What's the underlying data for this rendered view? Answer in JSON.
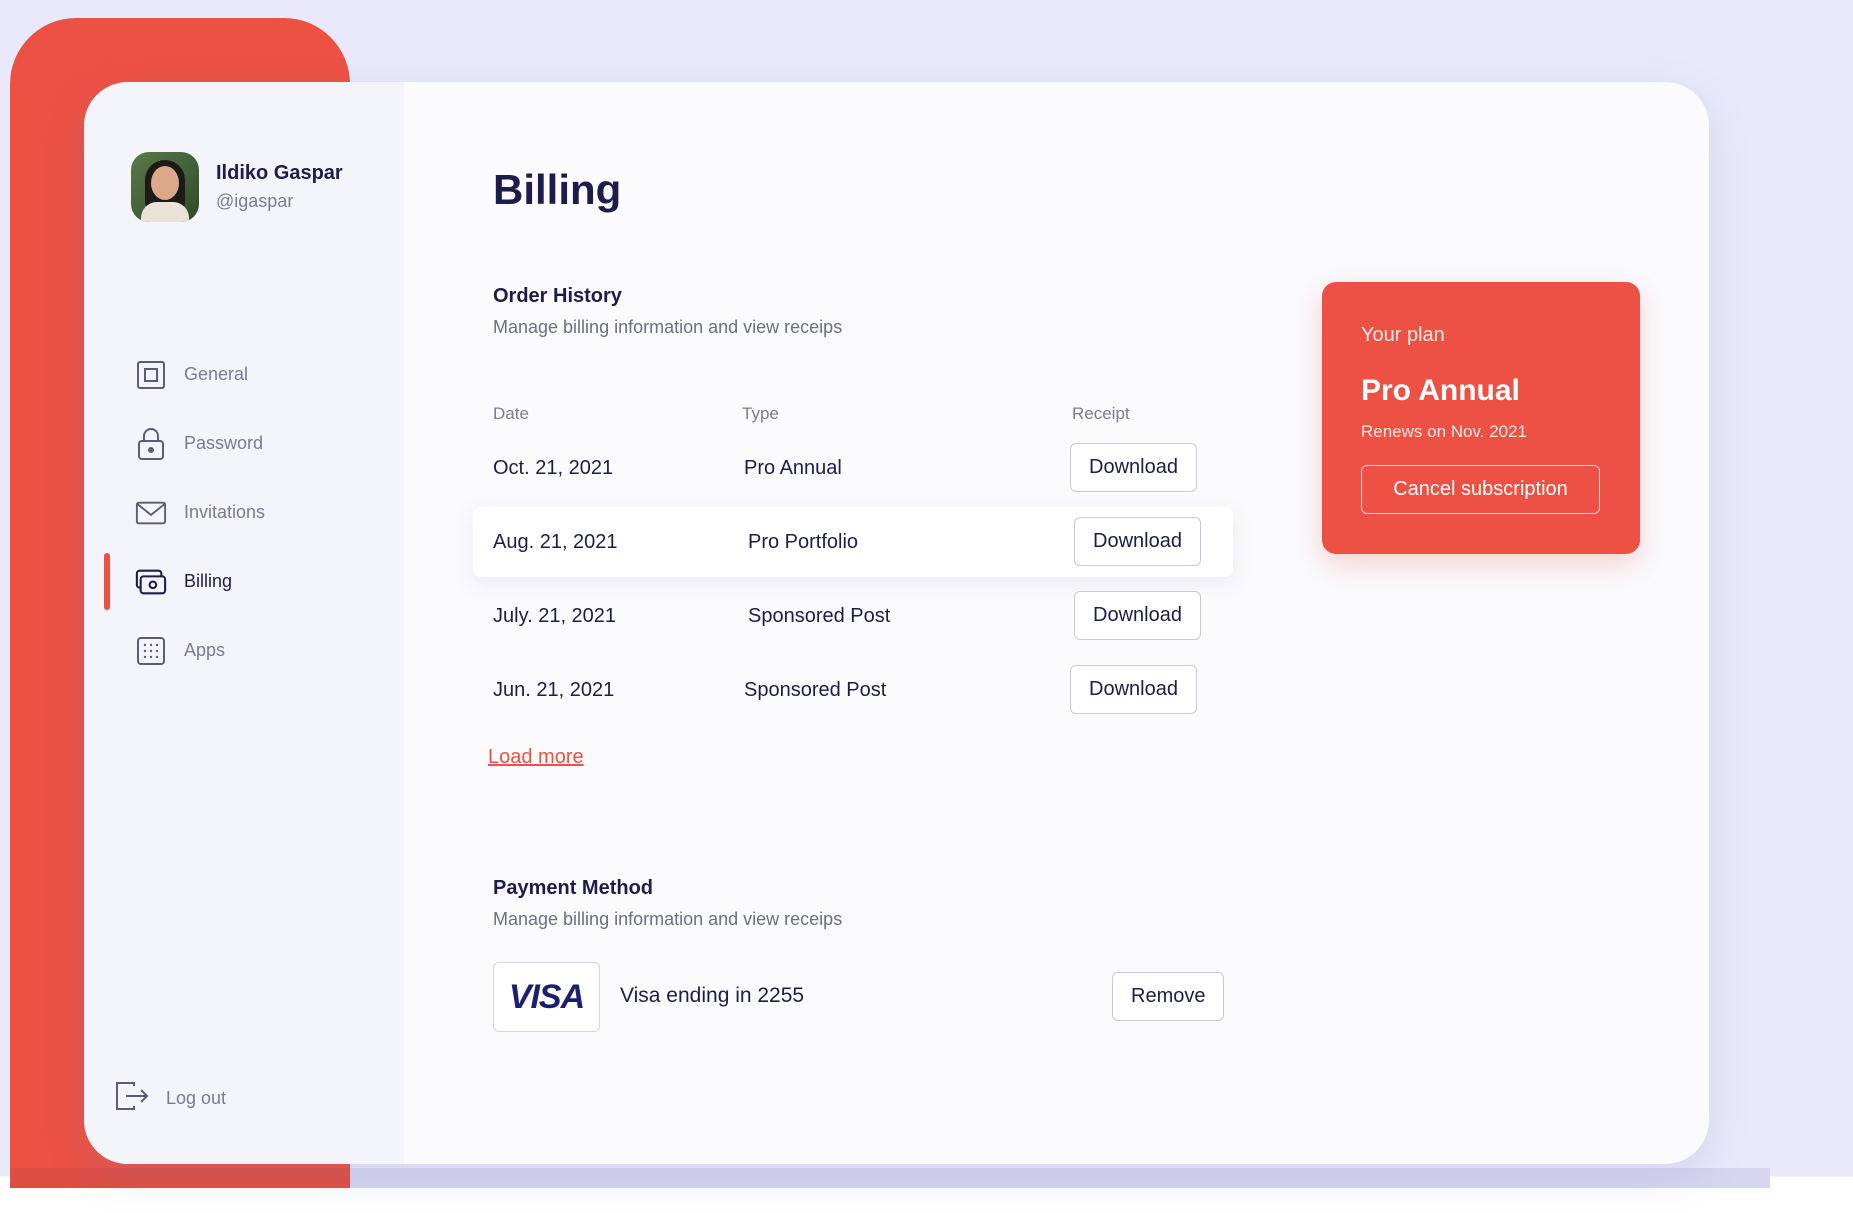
{
  "user": {
    "name": "Ildiko Gaspar",
    "handle": "@igaspar"
  },
  "nav": {
    "items": [
      {
        "label": "General",
        "icon": "square-icon"
      },
      {
        "label": "Password",
        "icon": "lock-icon"
      },
      {
        "label": "Invitations",
        "icon": "mail-icon"
      },
      {
        "label": "Billing",
        "icon": "billing-icon",
        "active": true
      },
      {
        "label": "Apps",
        "icon": "grid-icon"
      }
    ],
    "logout_label": "Log out"
  },
  "page": {
    "title": "Billing"
  },
  "orders": {
    "title": "Order History",
    "subtitle": "Manage billing information and view receips",
    "columns": [
      "Date",
      "Type",
      "Receipt"
    ],
    "rows": [
      {
        "date": "Oct. 21, 2021",
        "type": "Pro Annual",
        "action": "Download"
      },
      {
        "date": "Aug. 21, 2021",
        "type": "Pro Portfolio",
        "action": "Download"
      },
      {
        "date": "July. 21, 2021",
        "type": "Sponsored Post",
        "action": "Download"
      },
      {
        "date": "Jun. 21, 2021",
        "type": "Sponsored Post",
        "action": "Download"
      }
    ],
    "load_more": "Load more"
  },
  "payment": {
    "title": "Payment Method",
    "subtitle": "Manage billing information and view receips",
    "card_brand": "VISA",
    "card_text": "Visa ending in 2255",
    "remove_label": "Remove"
  },
  "plan": {
    "label": "Your plan",
    "name": "Pro Annual",
    "renews": "Renews on  Nov. 2021",
    "cancel_label": "Cancel subscription"
  },
  "colors": {
    "accent": "#ec5143",
    "text": "#1c1d4a",
    "muted": "#7a7b95",
    "background": "#e9e9fb"
  }
}
